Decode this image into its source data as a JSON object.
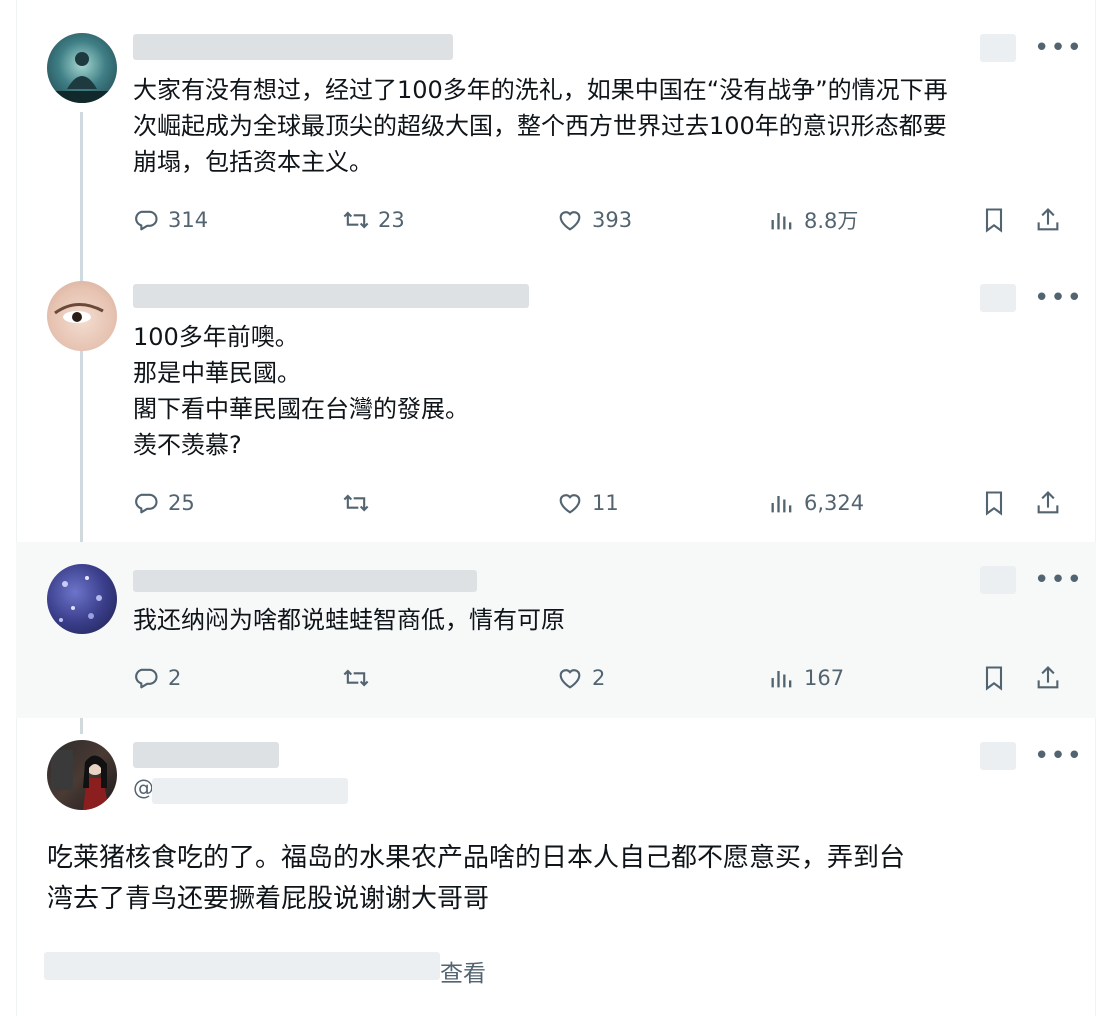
{
  "tweets": [
    {
      "text": "大家有没有想过，经过了100多年的洗礼，如果中国在“没有战争”的情况下再\n次崛起成为全球最顶尖的超级大国，整个西方世界过去100年的意识形态都要\n崩塌，包括资本主义。",
      "replies": "314",
      "retweets": "23",
      "likes": "393",
      "views": "8.8万"
    },
    {
      "text": "100多年前噢。\n那是中華民國。\n閣下看中華民國在台灣的發展。\n羡不羡慕?",
      "replies": "25",
      "retweets": "",
      "likes": "11",
      "views": "6,324"
    },
    {
      "text": "我还纳闷为啥都说蛙蛙智商低，情有可原",
      "replies": "2",
      "retweets": "",
      "likes": "2",
      "views": "167"
    }
  ],
  "focused": {
    "handle_prefix": "@",
    "text": "吃莱猪核食吃的了。福岛的水果农产品啥的日本人自己都不愿意买，弄到台\n湾去了青鸟还要撅着屁股说谢谢大哥哥",
    "view_label": "查看"
  },
  "icons": [
    "reply-icon",
    "retweet-icon",
    "like-icon",
    "views-icon",
    "bookmark-icon",
    "share-icon",
    "more-icon"
  ],
  "colors": {
    "muted": "#536471",
    "thread": "#cfd9de",
    "highlight_bg": "#f7f9f9"
  }
}
